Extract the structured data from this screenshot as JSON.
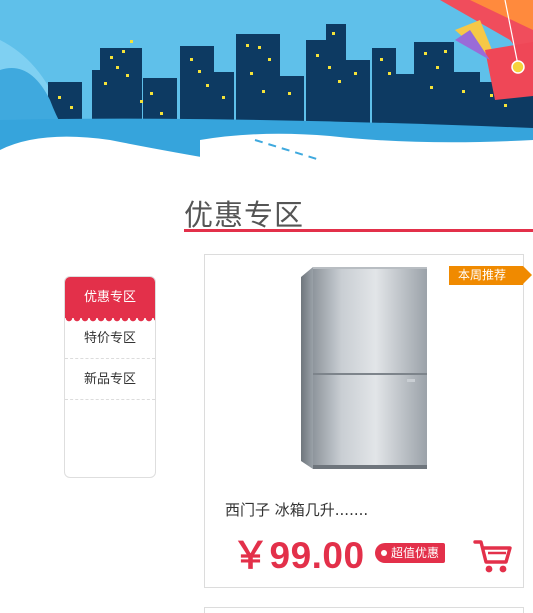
{
  "section": {
    "title": "优惠专区"
  },
  "nav": {
    "items": [
      {
        "label": "优惠专区",
        "active": true
      },
      {
        "label": "特价专区",
        "active": false
      },
      {
        "label": "新品专区",
        "active": false
      }
    ]
  },
  "product": {
    "badge": "本周推荐",
    "name": "西门子 冰箱几升.......",
    "price": "￥99.00",
    "tag": "超值优惠",
    "image": "refrigerator-image"
  },
  "icons": {
    "cart": "shopping-cart-icon"
  },
  "colors": {
    "accent": "#e3304a",
    "badge": "#f08a00",
    "sky": "#5bbbe8",
    "buildings": "#0d3a62"
  }
}
